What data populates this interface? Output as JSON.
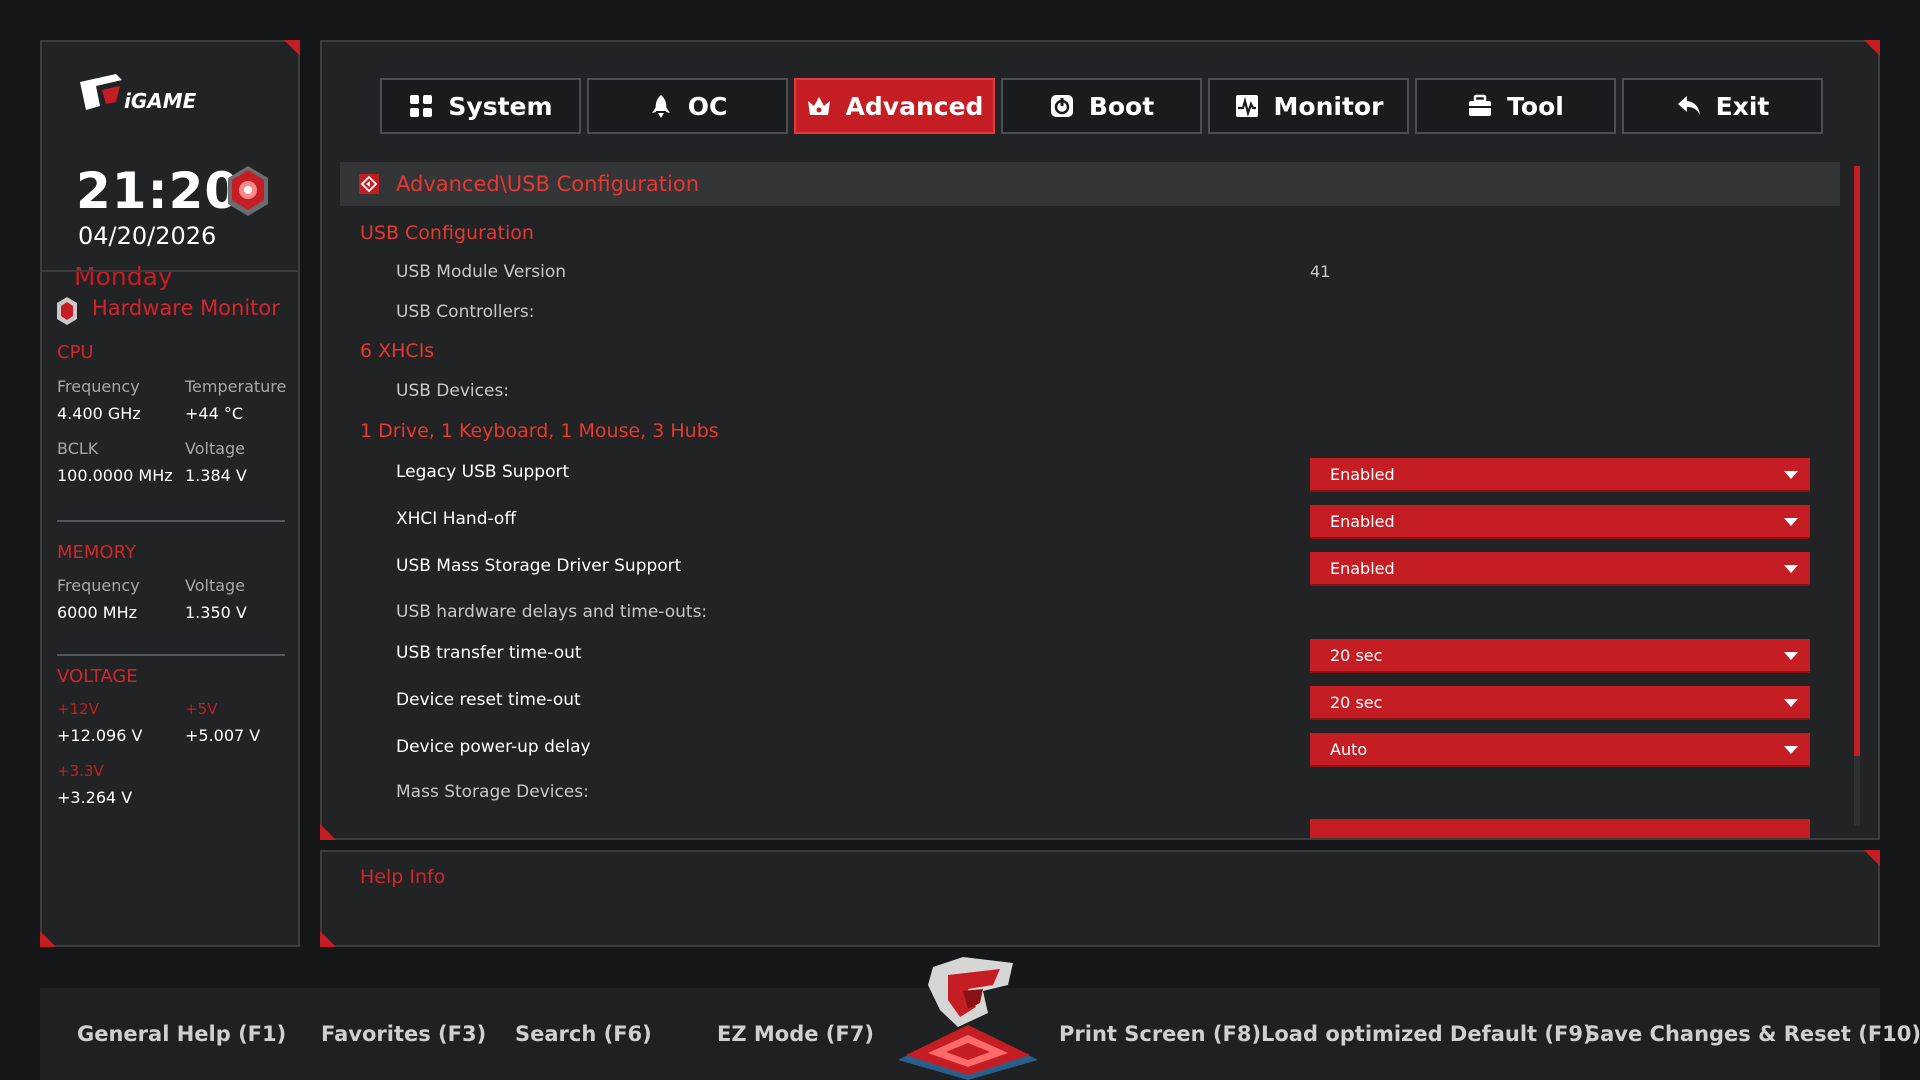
{
  "left_panel": {
    "time": "21:20",
    "date": "04/20/2026",
    "weekday": "Monday",
    "hardware_monitor": {
      "title": "Hardware Monitor",
      "cpu": {
        "title": "CPU",
        "frequency_label": "Frequency",
        "frequency_value": "4.400 GHz",
        "temperature_label": "Temperature",
        "temperature_value": "+44 °C",
        "bclk_label": "BCLK",
        "bclk_value": "100.0000 MHz",
        "voltage_label": "Voltage",
        "voltage_value": "1.384 V"
      },
      "memory": {
        "title": "MEMORY",
        "frequency_label": "Frequency",
        "frequency_value": "6000 MHz",
        "voltage_label": "Voltage",
        "voltage_value": "1.350 V"
      },
      "voltage": {
        "title": "VOLTAGE",
        "v12_label": "+12V",
        "v12_value": "+12.096 V",
        "v5_label": "+5V",
        "v5_value": "+5.007 V",
        "v33_label": "+3.3V",
        "v33_value": "+3.264 V"
      }
    }
  },
  "tabs": [
    {
      "label": "System",
      "icon": "grid-icon"
    },
    {
      "label": "OC",
      "icon": "rocket-icon"
    },
    {
      "label": "Advanced",
      "icon": "crown-icon",
      "active": true
    },
    {
      "label": "Boot",
      "icon": "power-icon"
    },
    {
      "label": "Monitor",
      "icon": "pulse-icon"
    },
    {
      "label": "Tool",
      "icon": "toolbox-icon"
    },
    {
      "label": "Exit",
      "icon": "exit-arrow-icon"
    }
  ],
  "breadcrumb": "Advanced\\USB Configuration",
  "content": {
    "usb_configuration": "USB Configuration",
    "usb_module_version_label": "USB Module Version",
    "usb_module_version_value": "41",
    "usb_controllers_label": "USB Controllers:",
    "xhcis": "6 XHCIs",
    "usb_devices_label": "USB Devices:",
    "devices_summary": "1 Drive, 1 Keyboard, 1 Mouse, 3 Hubs",
    "legacy_usb_label": "Legacy USB Support",
    "legacy_usb_value": "Enabled",
    "xhci_handoff_label": "XHCI Hand-off",
    "xhci_handoff_value": "Enabled",
    "mass_storage_driver_label": "USB Mass Storage Driver Support",
    "mass_storage_driver_value": "Enabled",
    "delays_label": "USB hardware delays and time-outs:",
    "transfer_timeout_label": "USB transfer time-out",
    "transfer_timeout_value": "20 sec",
    "reset_timeout_label": "Device reset time-out",
    "reset_timeout_value": "20 sec",
    "powerup_delay_label": "Device power-up delay",
    "powerup_delay_value": "Auto",
    "mass_storage_devices_label": "Mass Storage Devices:"
  },
  "help": {
    "title": "Help Info"
  },
  "footer": {
    "general_help": "General Help (F1)",
    "favorites": "Favorites (F3)",
    "search": "Search (F6)",
    "ez_mode": "EZ Mode (F7)",
    "print_screen": "Print Screen (F8)",
    "load_default": "Load optimized Default (F9)",
    "save_reset": "Save Changes & Reset (F10)"
  },
  "colors": {
    "accent": "#c41e24",
    "accent_text": "#e8382f",
    "panel": "#212324",
    "background": "#161718"
  }
}
